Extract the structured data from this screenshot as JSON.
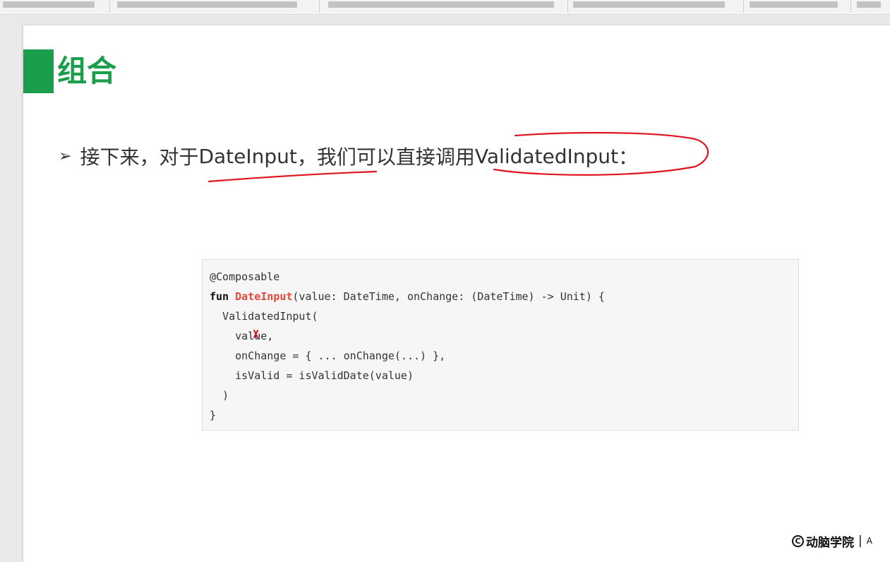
{
  "slide": {
    "title": "组合",
    "bullet": {
      "prefix": "接下来，对于 ",
      "highlight_one": "DateInput",
      "middle": "，我们可以直接调用 ",
      "highlight_two": "ValidatedInput",
      "suffix": "："
    },
    "code": {
      "line1": "@Composable",
      "line2_kw": "fun ",
      "line2_fn": "DateInput",
      "line2_rest": "(value: DateTime, onChange: (DateTime) -> Unit) {",
      "line3": "  ValidatedInput(",
      "line4": "    value,",
      "line5": "    onChange = { ... onChange(...) },",
      "line6": "    isValid = isValidDate(value)",
      "line7": "  )",
      "line8": "}"
    }
  },
  "footer": {
    "logo_mark": "C",
    "logo_text": "动脑学院",
    "separator": "|",
    "tail": "A"
  },
  "colors": {
    "accent_green": "#1b9e4b",
    "annotation_red": "#e0141e",
    "function_name": "#e0483c"
  }
}
